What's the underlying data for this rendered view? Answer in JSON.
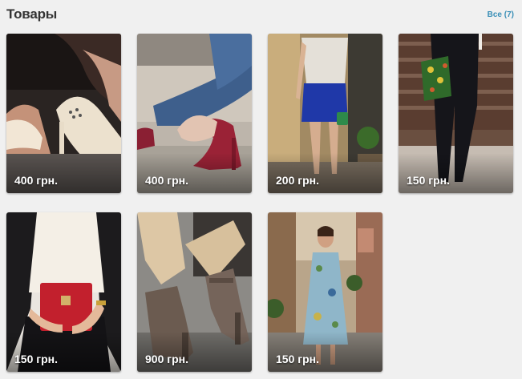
{
  "header": {
    "title": "Товары",
    "all_link": "Все (7)"
  },
  "products": [
    {
      "price": "400 грн.",
      "image": "cream-high-heel-pumps-photo"
    },
    {
      "price": "400 грн.",
      "image": "burgundy-suede-pumps-photo"
    },
    {
      "price": "200 грн.",
      "image": "blue-skirt-outfit-photo"
    },
    {
      "price": "150 грн.",
      "image": "floral-clutch-outfit-photo"
    },
    {
      "price": "150 грн.",
      "image": "red-handbag-outfit-photo"
    },
    {
      "price": "900 грн.",
      "image": "brown-ankle-boots-photo"
    },
    {
      "price": "150 грн.",
      "image": "printed-dress-photo"
    }
  ],
  "colors": {
    "background": "#f0f0f0",
    "title": "#333333",
    "link": "#3a8fb7",
    "price_text": "#ffffff"
  }
}
